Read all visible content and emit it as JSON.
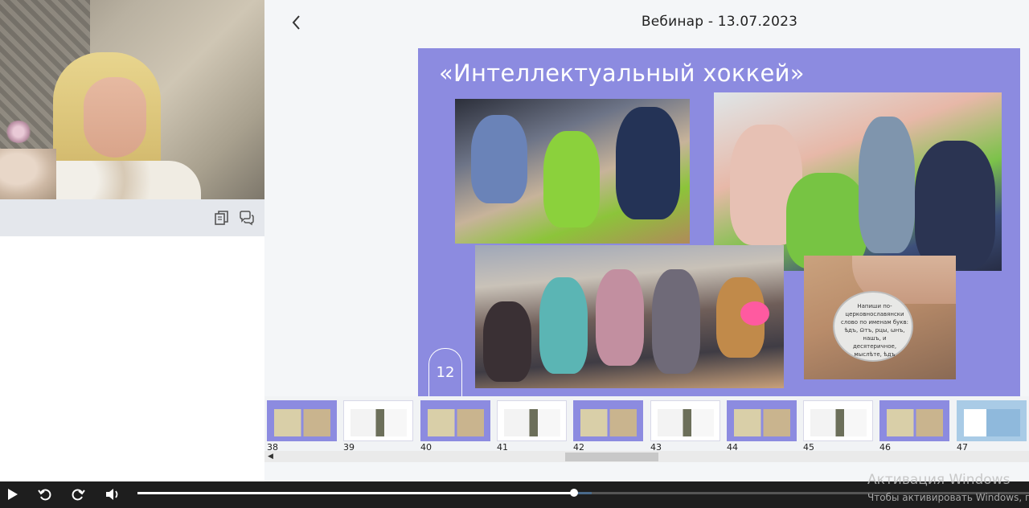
{
  "header": {
    "title": "Вебинар - 13.07.2023",
    "back_icon": "chevron-left-icon"
  },
  "video": {
    "toolbar_icons": [
      "copy-icon",
      "chat-icon"
    ]
  },
  "slide": {
    "title": "«Интеллектуальный хоккей»",
    "number": "12",
    "card_text": "Напиши по-церковнославянски слово по именам букв: ѣдъ, ѿтъ, рцы, ѡнъ, нашъ, и десятеричное, мыслѣте, ѣдъ"
  },
  "thumbnails": [
    {
      "number": "38",
      "style": "purple",
      "active": false
    },
    {
      "number": "39",
      "style": "white",
      "active": false
    },
    {
      "number": "40",
      "style": "purple",
      "active": false
    },
    {
      "number": "41",
      "style": "white",
      "active": false
    },
    {
      "number": "42",
      "style": "purple",
      "active": false
    },
    {
      "number": "43",
      "style": "white",
      "active": false
    },
    {
      "number": "44",
      "style": "purple",
      "active": false
    },
    {
      "number": "45",
      "style": "white",
      "active": false
    },
    {
      "number": "46",
      "style": "purple",
      "active": false
    },
    {
      "number": "47",
      "style": "blue",
      "active": false
    }
  ],
  "player": {
    "progress": 0.49,
    "buffered": 0.51,
    "buttons": [
      "play-icon",
      "rewind-icon",
      "forward-icon",
      "volume-icon"
    ]
  },
  "watermark": {
    "line1": "Активация Windows",
    "line2": "Чтобы активировать Windows, п"
  },
  "colors": {
    "slide_bg": "#8c8be0",
    "player_bg": "#1e1e1e",
    "toolbar_bg": "#e4e7ec"
  }
}
